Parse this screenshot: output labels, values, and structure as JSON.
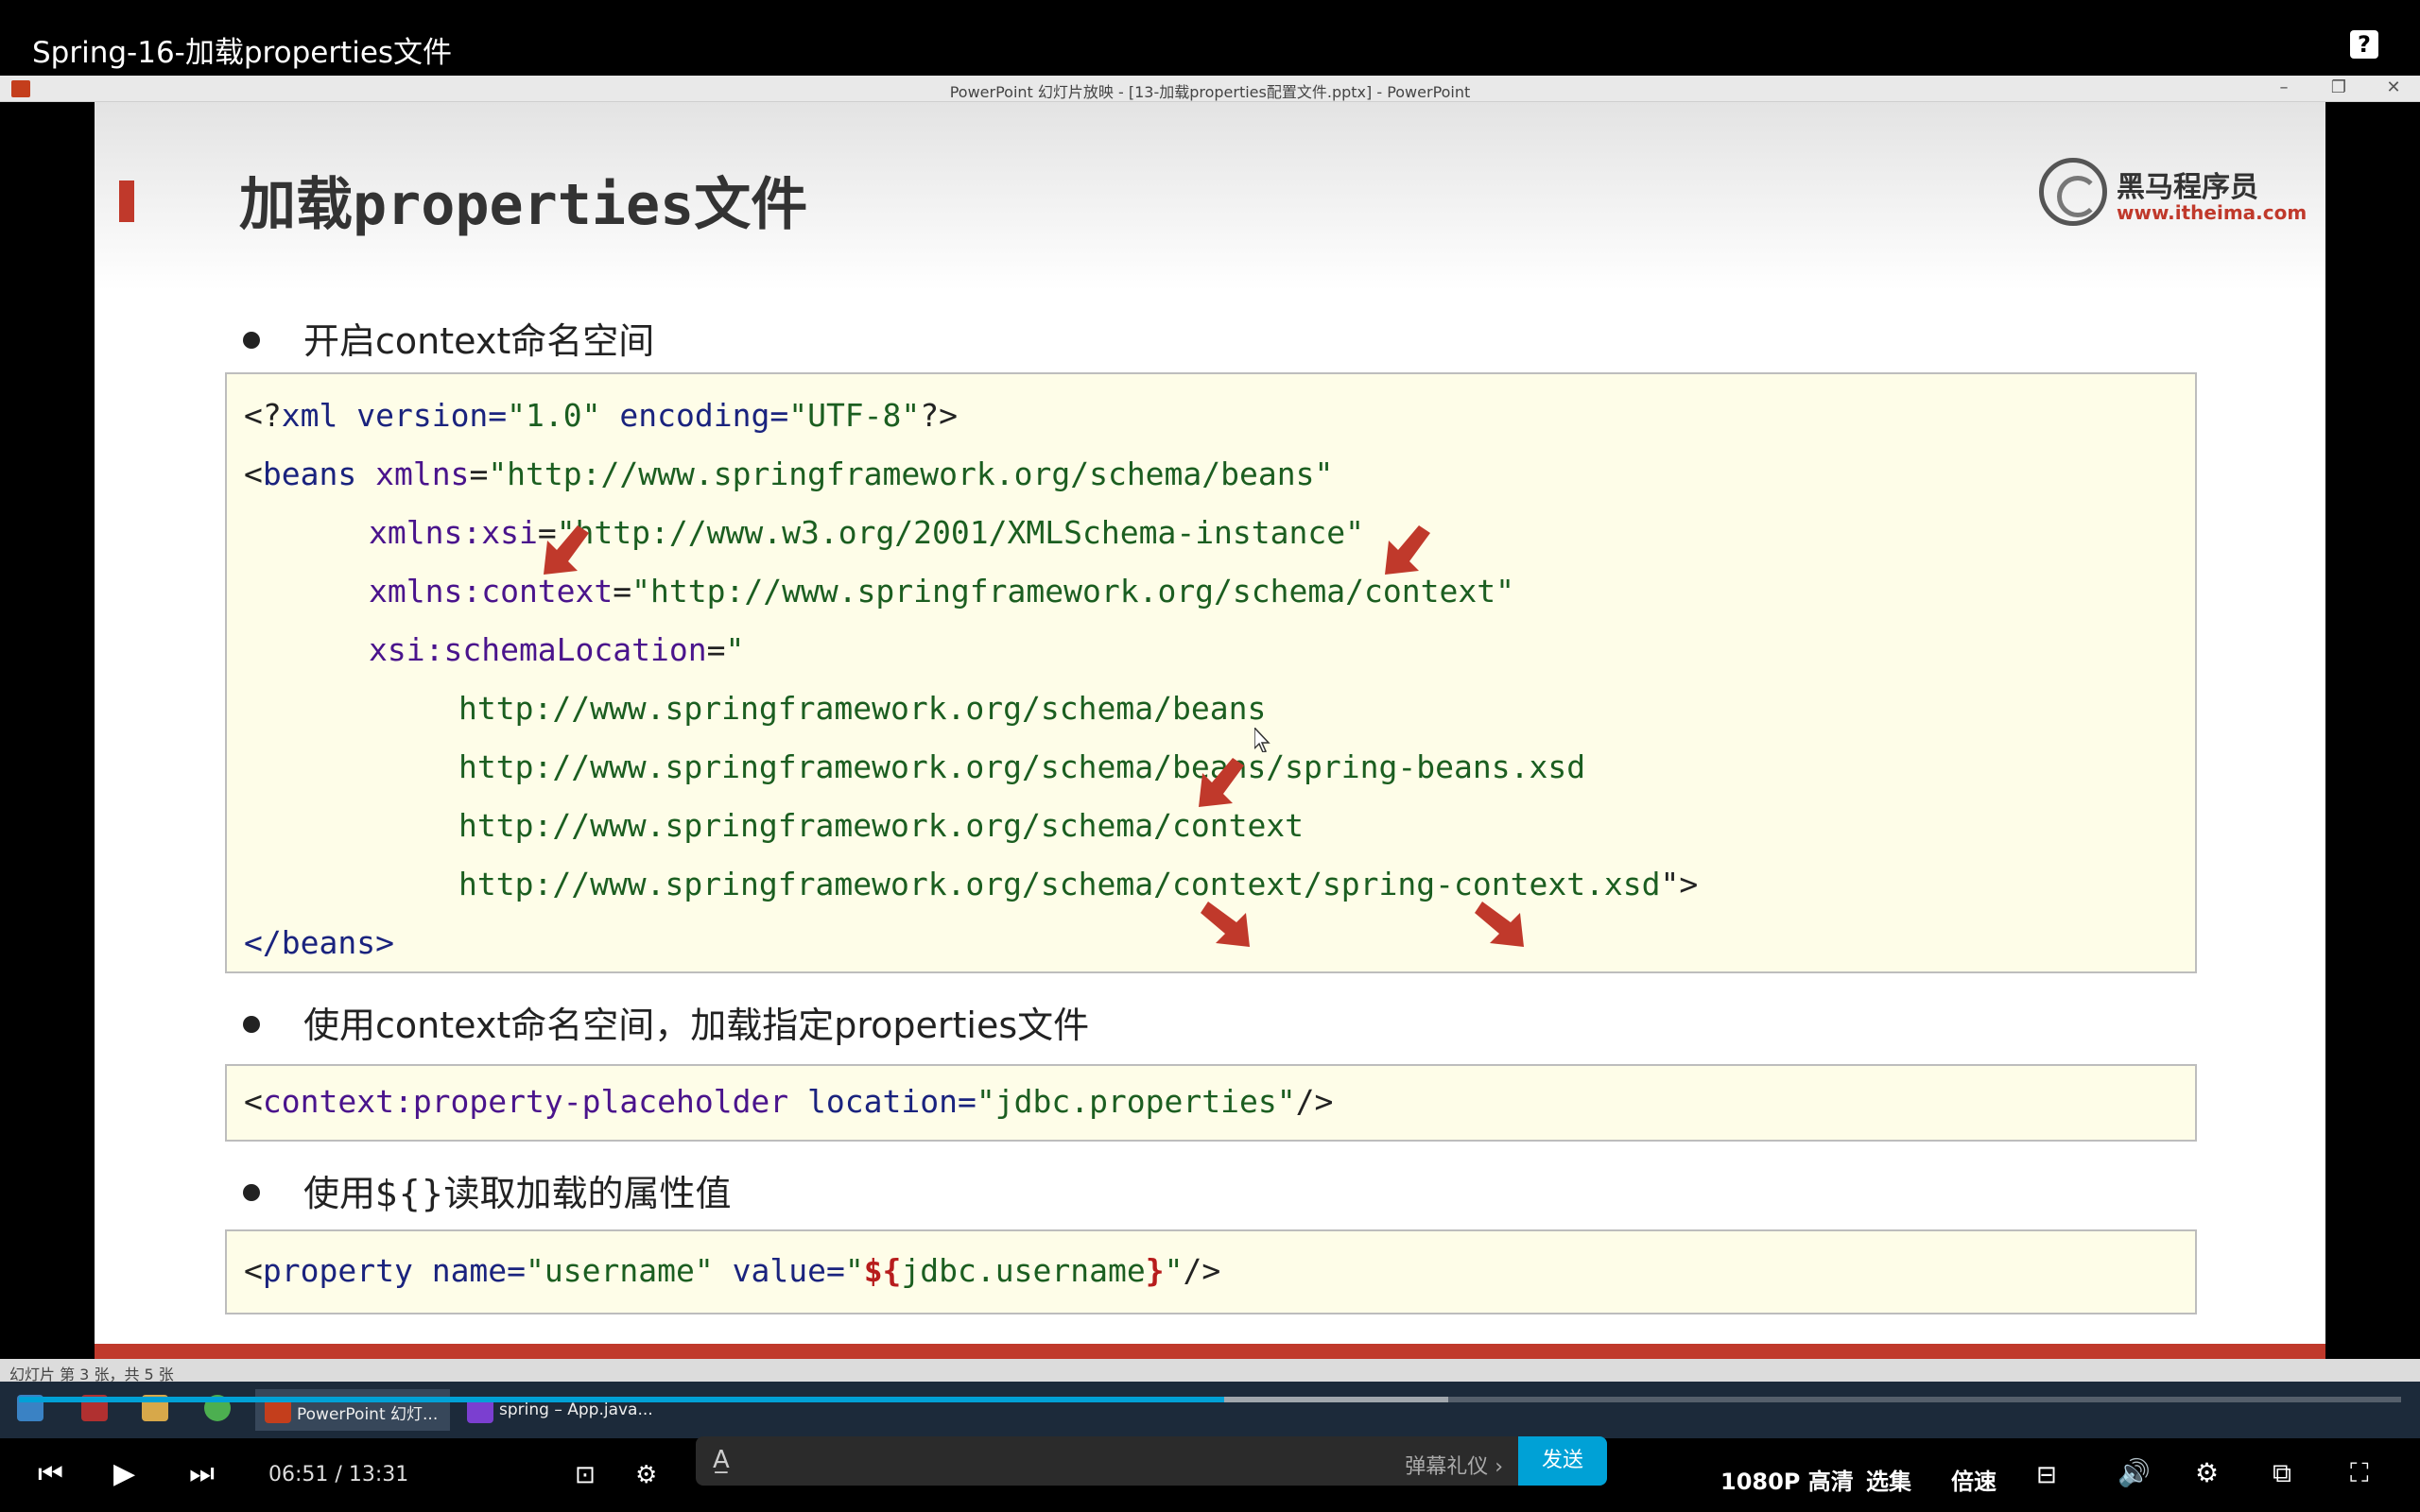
{
  "video": {
    "title": "Spring-16-加载properties文件",
    "help_label": "?"
  },
  "ppt_window": {
    "title": "PowerPoint 幻灯片放映 - [13-加载properties配置文件.pptx] - PowerPoint",
    "minimize": "–",
    "restore": "❐",
    "close": "✕"
  },
  "slide": {
    "title": "加载properties文件",
    "logo_cn": "黑马程序员",
    "logo_url": "www.itheima.com",
    "bullet1": "开启context命名空间",
    "bullet2": "使用context命名空间，加载指定properties文件",
    "bullet3": "使用${}读取加载的属性值",
    "code1": {
      "l1a": "<?",
      "l1b": "xml",
      "l1c": " version=",
      "l1d": "\"1.0\"",
      "l1e": " encoding=",
      "l1f": "\"UTF-8\"",
      "l1g": "?>",
      "l2a": "<",
      "l2b": "beans",
      "l2c": " xmlns",
      "l2d": "=",
      "l2e": "\"http://www.springframework.org/schema/beans\"",
      "l3a": "xmlns:xsi",
      "l3b": "=",
      "l3c": "\"http://www.w3.org/2001/XMLSchema-instance\"",
      "l4a": "xmlns:context",
      "l4b": "=",
      "l4c": "\"http://www.springframework.org/schema/context\"",
      "l5a": "xsi:schemaLocation",
      "l5b": "=",
      "l5c": "\"",
      "l6": "http://www.springframework.org/schema/beans",
      "l7": "http://www.springframework.org/schema/beans/spring-beans.xsd",
      "l8": "http://www.springframework.org/schema/context",
      "l9": "http://www.springframework.org/schema/context/spring-context.xsd",
      "l9b": "\">",
      "l10": "</beans>"
    },
    "code2": {
      "a": "<",
      "b": "context:property-placeholder",
      "c": " location=",
      "d": "\"jdbc.properties\"",
      "e": "/>"
    },
    "code3": {
      "a": "<",
      "b": "property",
      "c": " name=",
      "d": "\"username\"",
      "e": " value=",
      "f": "\"",
      "g": "${",
      "h": "jdbc.username",
      "i": "}",
      "j": "\"",
      "k": "/>"
    }
  },
  "statusbar": {
    "text": "幻灯片 第 3 张，共 5 张"
  },
  "taskbar": {
    "items": [
      "PowerPoint 幻灯...",
      "spring – App.java..."
    ]
  },
  "player": {
    "current_time": "06:51",
    "separator": "/",
    "duration": "13:31",
    "progress": 0.506,
    "buffered": 0.6,
    "danmaku_etiquette": "弹幕礼仪 ›",
    "send_label": "发送",
    "quality": "1080P 高清",
    "episodes": "选集",
    "speed": "倍速",
    "accent_color": "#00a1d6"
  }
}
